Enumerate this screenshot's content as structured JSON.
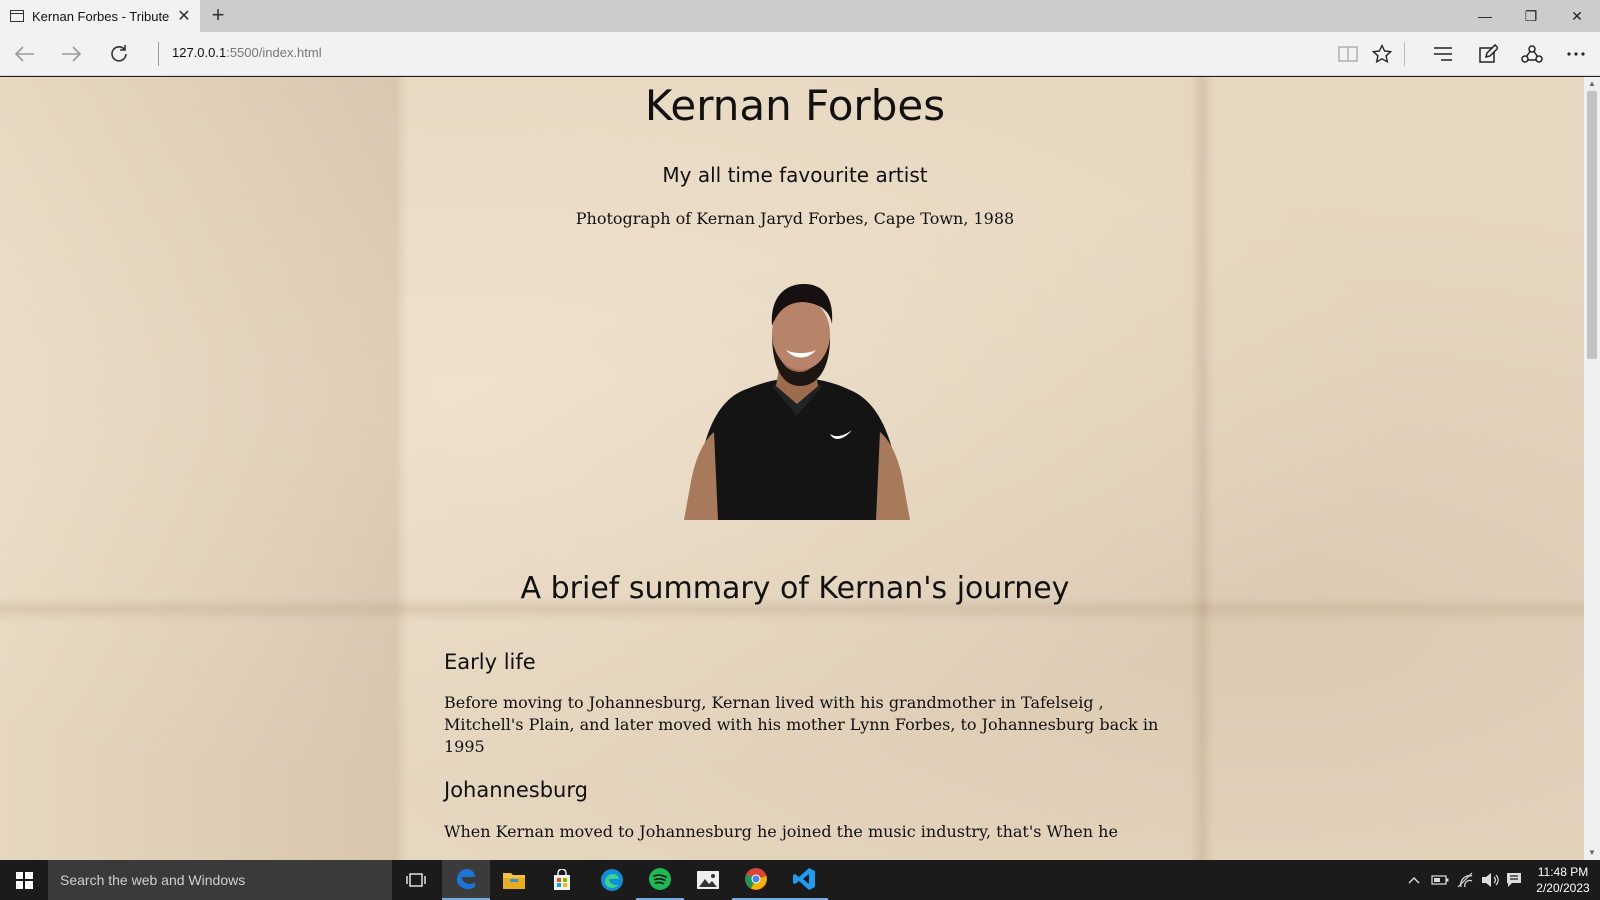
{
  "browser": {
    "tab_title": "Kernan Forbes - Tribute",
    "url_host": "127.0.0.1",
    "url_path": ":5500/index.html"
  },
  "page": {
    "title": "Kernan Forbes",
    "subtitle": "My all time favourite artist",
    "image_caption": "Photograph of Kernan Jaryd Forbes, Cape Town, 1988",
    "summary_heading": "A brief summary of Kernan's journey",
    "sections": [
      {
        "heading": "Early life",
        "text": "Before moving to Johannesburg, Kernan lived with his grandmother in Tafelseig , Mitchell's Plain, and later moved with his mother Lynn Forbes, to Johannesburg back in 1995"
      },
      {
        "heading": "Johannesburg",
        "text": "When Kernan moved to Johannesburg he joined the music industry, that's When he"
      }
    ]
  },
  "taskbar": {
    "search_placeholder": "Search the web and Windows",
    "time": "11:48 PM",
    "date": "2/20/2023"
  },
  "colors": {
    "page_background": "#e6d7c0",
    "taskbar": "#1b1b1b",
    "edge_blue": "#1e74d6",
    "spotify_green": "#1db954",
    "vscode_blue": "#1f9cf0"
  }
}
